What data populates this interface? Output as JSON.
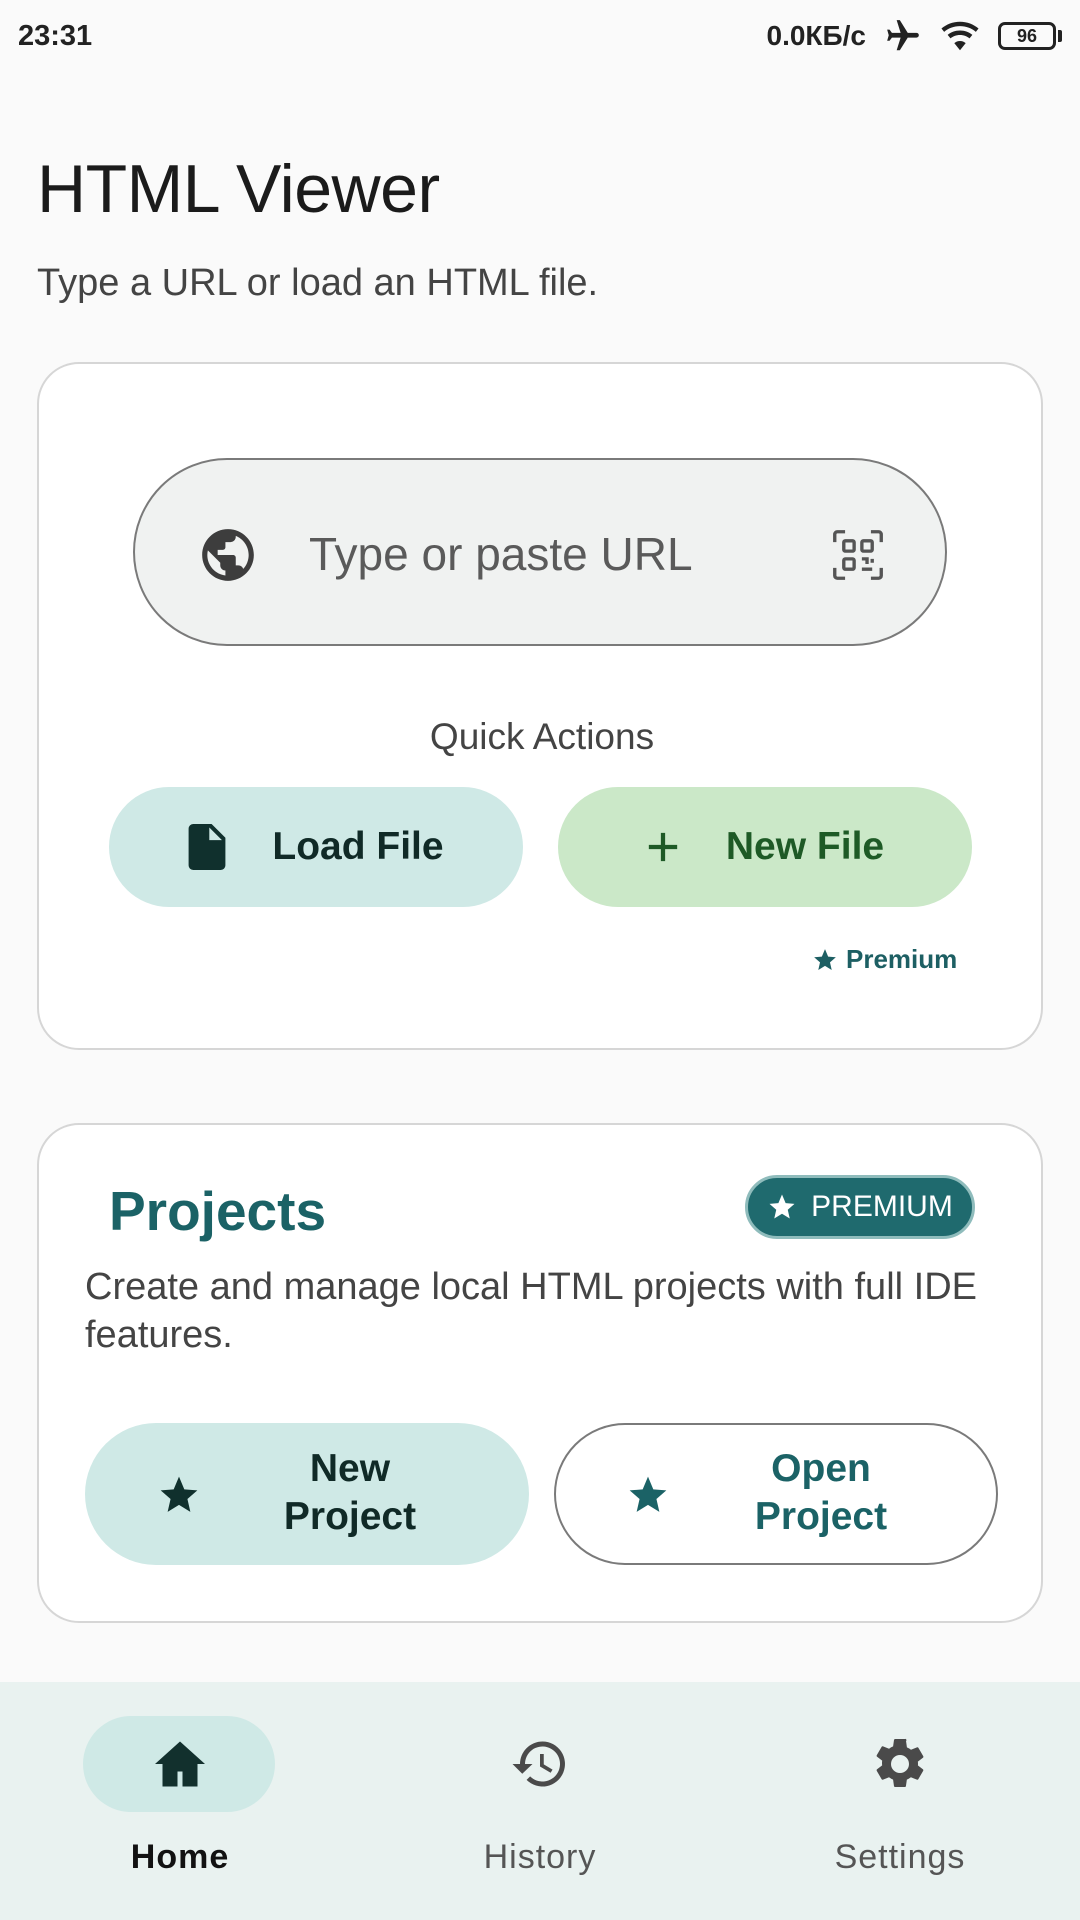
{
  "status_bar": {
    "time": "23:31",
    "network_speed": "0.0КБ/с",
    "battery_level": "96",
    "icons": [
      "airplane-mode-icon",
      "wifi-icon",
      "battery-icon"
    ]
  },
  "header": {
    "title": "HTML Viewer",
    "subtitle": "Type a URL or load an HTML file."
  },
  "url_card": {
    "url_placeholder": "Type or paste URL",
    "leading_icon": "globe-icon",
    "trailing_icon": "qr-scan-icon",
    "quick_actions_label": "Quick Actions",
    "load_file_label": "Load File",
    "new_file_label": "New File",
    "premium_note": "Premium"
  },
  "projects_card": {
    "title": "Projects",
    "badge_label": "PREMIUM",
    "description": "Create and manage local HTML projects with full IDE features.",
    "new_project_label_1": "New",
    "new_project_label_2": "Project",
    "open_project_label_1": "Open",
    "open_project_label_2": "Project"
  },
  "bottom_nav": {
    "items": [
      {
        "label": "Home",
        "icon": "home-icon",
        "active": true
      },
      {
        "label": "History",
        "icon": "history-icon",
        "active": false
      },
      {
        "label": "Settings",
        "icon": "gear-icon",
        "active": false
      }
    ]
  },
  "colors": {
    "accent_teal": "#1b6266",
    "tonal_teal_bg": "#cfe9e6",
    "tonal_green_bg": "#cbe8c8",
    "nav_bg": "#e9f2f0"
  }
}
